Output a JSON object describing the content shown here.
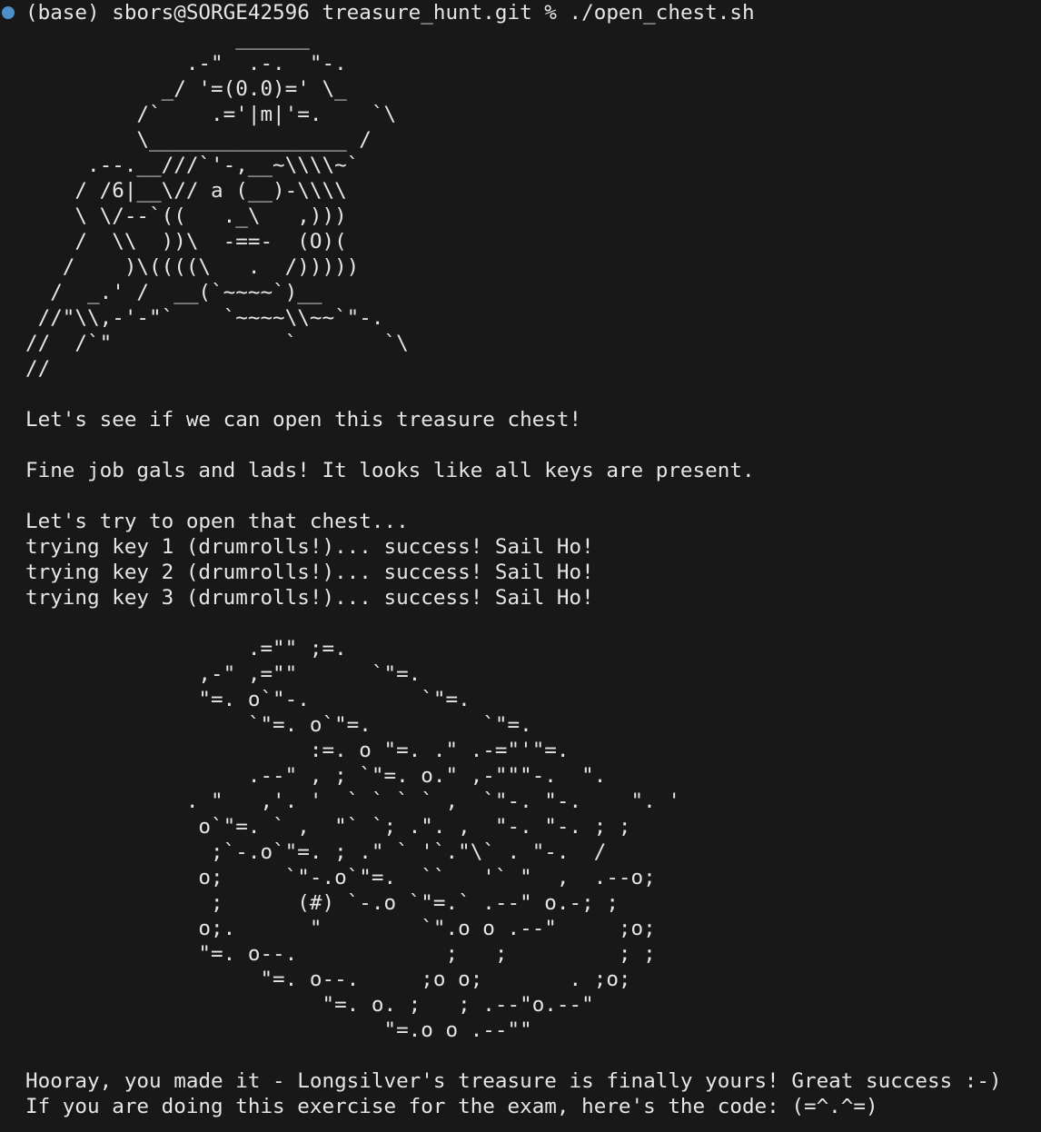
{
  "prompt": {
    "text": "(base) sbors@SORGE42596 treasure_hunt.git % ",
    "command": "./open_chest.sh",
    "indicator_color": "#4c8fc9"
  },
  "pirate_art": "                 ______\n             .-\"  .-.  \"-.\n           _/ '=(0.0)=' \\_\n         /`    .='|m|'=.    `\\\n         \\________________ /\n     .--.__///`'-,__~\\\\\\\\~`\n    / /6|__\\// a (__)-\\\\\\\\\n    \\ \\/--`((   ._\\   ,)))\n    /  \\\\  ))\\  -==-  (O)(\n   /    )\\((((\\   .  /)))))\n  /  _.' /  __(`~~~~`)__\n //\"\\\\,-'-\"`    `~~~~\\\\~~`\"-.\n//  /`\"              `       `\\\n//",
  "messages": {
    "intro": "Let's see if we can open this treasure chest!",
    "keys_present": "Fine job gals and lads! It looks like all keys are present.",
    "trying": "Let's try to open that chest...",
    "key1": "trying key 1 (drumrolls!)... success! Sail Ho!",
    "key2": "trying key 2 (drumrolls!)... success! Sail Ho!",
    "key3": "trying key 3 (drumrolls!)... success! Sail Ho!"
  },
  "chest_art": "                  .=\"\" ;=.\n              ,-\" ,=\"\"      `\"=.\n              \"=. o`\"-.         `\"=.\n                  `\"=. o`\"=.         `\"=.\n                       :=. o \"=. .\" .-=\"'\"=.\n                  .--\" , ; `\"=. o.\" ,-\"\"\"-.  \".\n             . \"   ,'. '  ` ` ` ` ,  `\"-. \"-.    \". '\n              o`\"=. ` ,  \"` `; .\". ,  \"-. \"-. ; ;\n               ;`-.o`\"=. ; .\" ` '`.\"\\` . \"-.  /\n              o;     `\"-.o`\"=.  ``   '` \"  ,  .--o;\n               ;      (#) `-.o `\"=.` .--\" o.-; ;\n              o;.      \"        `\".o o .--\"     ;o;\n              \"=. o--.            ;   ;         ; ;\n                   \"=. o--.     ;o o;       . ;o;\n                        \"=. o. ;   ; .--\"o.--\"\n                             \"=.o o .--\"\"",
  "final": {
    "hooray": "Hooray, you made it - Longsilver's treasure is finally yours! Great success :-)",
    "code": "If you are doing this exercise for the exam, here's the code: (=^.^=)"
  }
}
